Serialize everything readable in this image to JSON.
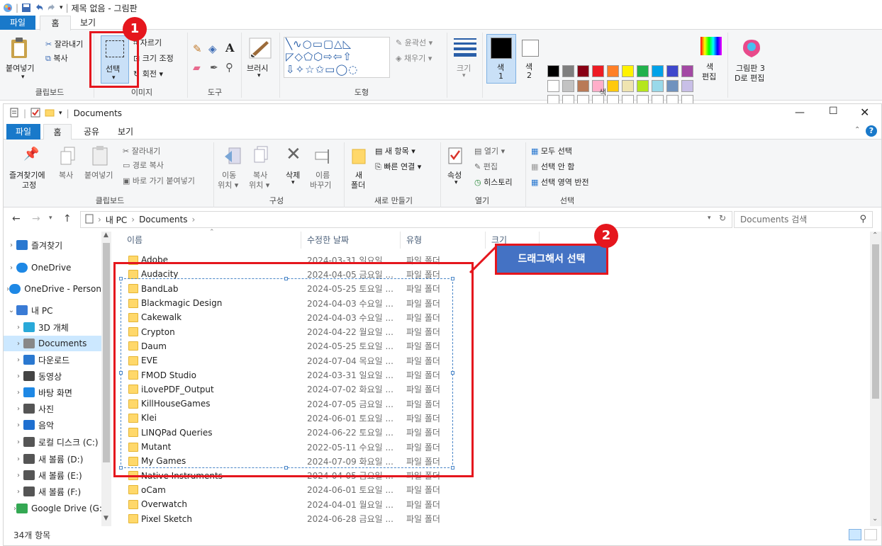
{
  "paint": {
    "title": "제목 없음 - 그림판",
    "tabs": {
      "file": "파일",
      "home": "홈",
      "view": "보기"
    },
    "clipboard": {
      "paste": "붙여넣기",
      "cut": "잘라내기",
      "copy": "복사",
      "group": "클립보드"
    },
    "image": {
      "select": "선택",
      "crop": "자르기",
      "resize": "크기 조정",
      "rotate": "회전",
      "group": "이미지"
    },
    "tools": {
      "group": "도구"
    },
    "brushes": {
      "label": "브러시"
    },
    "shapes": {
      "outline": "윤곽선",
      "fill": "채우기",
      "group": "도형"
    },
    "size": {
      "label": "크기"
    },
    "colors": {
      "color1": "색\n1",
      "color1_a": "색",
      "color1_b": "1",
      "color2_a": "색",
      "color2_b": "2",
      "edit_a": "색",
      "edit_b": "편집",
      "group": "색",
      "row1": [
        "#000000",
        "#7f7f7f",
        "#880015",
        "#ed1c24",
        "#ff7f27",
        "#fff200",
        "#22b14c",
        "#00a2e8",
        "#3f48cc",
        "#a349a4"
      ],
      "row2": [
        "#ffffff",
        "#c3c3c3",
        "#b97a57",
        "#ffaec9",
        "#ffc90e",
        "#efe4b0",
        "#b5e61d",
        "#99d9ea",
        "#7092be",
        "#c8bfe7"
      ]
    },
    "paint3d": {
      "line1": "그림판 3",
      "line2": "D로 편집"
    }
  },
  "explorer": {
    "title": "Documents",
    "tabs": {
      "file": "파일",
      "home": "홈",
      "share": "공유",
      "view": "보기"
    },
    "clipboard": {
      "pin": "즐겨찾기에",
      "pin2": "고정",
      "copy": "복사",
      "paste": "붙여넣기",
      "cut": "잘라내기",
      "copy_path": "경로 복사",
      "paste_shortcut": "바로 가기 붙여넣기",
      "group": "클립보드"
    },
    "organize": {
      "move1": "이동",
      "move2": "위치",
      "copy1": "복사",
      "copy2": "위치",
      "delete": "삭제",
      "rename1": "이름",
      "rename2": "바꾸기",
      "group": "구성"
    },
    "new": {
      "folder1": "새",
      "folder2": "폴더",
      "new_item": "새 항목",
      "easy_access": "빠른 연결",
      "group": "새로 만들기"
    },
    "open": {
      "props": "속성",
      "open": "열기",
      "edit": "편집",
      "history": "히스토리",
      "group": "열기"
    },
    "select": {
      "all": "모두 선택",
      "none": "선택 안 함",
      "invert": "선택 영역 반전",
      "group": "선택"
    },
    "address": {
      "pc": "내 PC",
      "folder": "Documents"
    },
    "search_placeholder": "Documents 검색",
    "nav": [
      {
        "label": "즐겨찾기",
        "icon": "star-icon"
      },
      {
        "label": "OneDrive",
        "icon": "cloud-icon"
      },
      {
        "label": "OneDrive - Person",
        "icon": "cloud-icon"
      },
      {
        "label": "내 PC",
        "icon": "pc-icon"
      },
      {
        "label": "3D 개체",
        "icon": "cube-icon"
      },
      {
        "label": "Documents",
        "icon": "document-icon"
      },
      {
        "label": "다운로드",
        "icon": "download-icon"
      },
      {
        "label": "동영상",
        "icon": "video-icon"
      },
      {
        "label": "바탕 화면",
        "icon": "desktop-icon"
      },
      {
        "label": "사진",
        "icon": "picture-icon"
      },
      {
        "label": "음악",
        "icon": "music-icon"
      },
      {
        "label": "로컬 디스크 (C:)",
        "icon": "drive-icon"
      },
      {
        "label": "새 볼륨 (D:)",
        "icon": "drive-icon"
      },
      {
        "label": "새 볼륨 (E:)",
        "icon": "drive-icon"
      },
      {
        "label": "새 볼륨 (F:)",
        "icon": "drive-icon"
      },
      {
        "label": "Google Drive (G:)",
        "icon": "google-drive-icon"
      }
    ],
    "columns": {
      "name": "이름",
      "modified": "수정한 날짜",
      "type": "유형",
      "size": "크기"
    },
    "files": [
      {
        "name": "Adobe",
        "date": "2024-03-31 일요일 ...",
        "type": "파일 폴더"
      },
      {
        "name": "Audacity",
        "date": "2024-04-05 금요일 ...",
        "type": "파일 폴더"
      },
      {
        "name": "BandLab",
        "date": "2024-05-25 토요일 ...",
        "type": "파일 폴더"
      },
      {
        "name": "Blackmagic Design",
        "date": "2024-04-03 수요일 ...",
        "type": "파일 폴더"
      },
      {
        "name": "Cakewalk",
        "date": "2024-04-03 수요일 ...",
        "type": "파일 폴더"
      },
      {
        "name": "Crypton",
        "date": "2024-04-22 월요일 ...",
        "type": "파일 폴더"
      },
      {
        "name": "Daum",
        "date": "2024-05-25 토요일 ...",
        "type": "파일 폴더"
      },
      {
        "name": "EVE",
        "date": "2024-07-04 목요일 ...",
        "type": "파일 폴더"
      },
      {
        "name": "FMOD Studio",
        "date": "2024-03-31 일요일 ...",
        "type": "파일 폴더"
      },
      {
        "name": "iLovePDF_Output",
        "date": "2024-07-02 화요일 ...",
        "type": "파일 폴더"
      },
      {
        "name": "KillHouseGames",
        "date": "2024-07-05 금요일 ...",
        "type": "파일 폴더"
      },
      {
        "name": "Klei",
        "date": "2024-06-01 토요일 ...",
        "type": "파일 폴더"
      },
      {
        "name": "LINQPad Queries",
        "date": "2024-06-22 토요일 ...",
        "type": "파일 폴더"
      },
      {
        "name": "Mutant",
        "date": "2022-05-11 수요일 ...",
        "type": "파일 폴더"
      },
      {
        "name": "My Games",
        "date": "2024-07-09 화요일 ...",
        "type": "파일 폴더"
      },
      {
        "name": "Native Instruments",
        "date": "2024-04-05 금요일 ...",
        "type": "파일 폴더"
      },
      {
        "name": "oCam",
        "date": "2024-06-01 토요일 ...",
        "type": "파일 폴더"
      },
      {
        "name": "Overwatch",
        "date": "2024-04-01 월요일 ...",
        "type": "파일 폴더"
      },
      {
        "name": "Pixel Sketch",
        "date": "2024-06-28 금요일 ...",
        "type": "파일 폴더"
      }
    ],
    "status": "34개 항목"
  },
  "annotations": {
    "badge1": "1",
    "badge2": "2",
    "callout": "드래그해서 선택"
  }
}
